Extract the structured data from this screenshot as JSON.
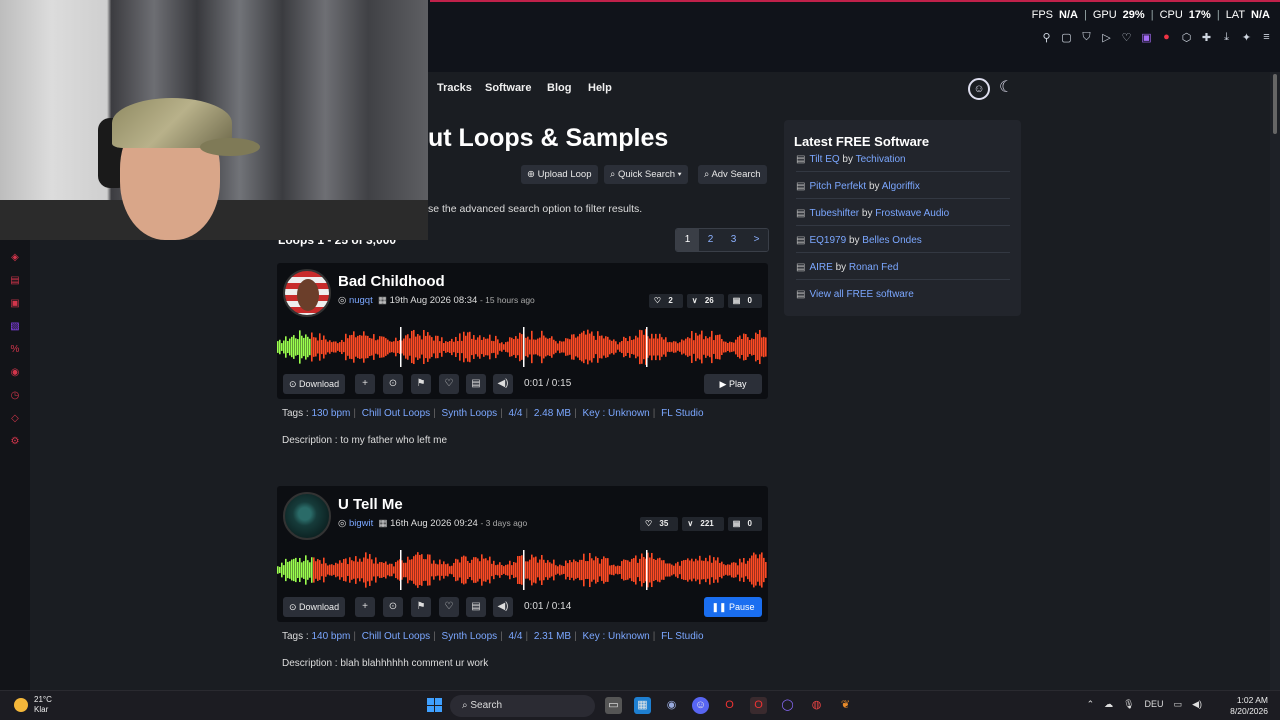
{
  "overlay": {
    "fps_label": "FPS",
    "fps_value": "N/A",
    "gpu_label": "GPU",
    "gpu_value": "29%",
    "cpu_label": "CPU",
    "cpu_value": "17%",
    "lat_label": "LAT",
    "lat_value": "N/A"
  },
  "nav": {
    "tracks": "Tracks",
    "software": "Software",
    "blog": "Blog",
    "help": "Help"
  },
  "page": {
    "title": "ut Loops & Samples",
    "upload_loop": "Upload Loop",
    "quick_search": "Quick Search",
    "adv_search": "Adv Search",
    "hint": "se the advanced search option to filter results.",
    "count": "Loops 1 - 25 of 3,000",
    "pages": [
      "1",
      "2",
      "3",
      ">"
    ]
  },
  "loops": [
    {
      "title": "Bad Childhood",
      "user": "nugqt",
      "date": "19th Aug 2026 08:34",
      "ago": "- 15 hours ago",
      "likes": "2",
      "downs": "26",
      "comments": "0",
      "download": "Download",
      "time": "0:01 / 0:15",
      "play": "Play",
      "tags_label": "Tags :",
      "tags": [
        "130 bpm",
        "Chill Out Loops",
        "Synth Loops",
        "4/4",
        "2.48 MB",
        "Key : Unknown",
        "FL Studio"
      ],
      "description": "Description : to my father who left me"
    },
    {
      "title": "U Tell Me",
      "user": "bigwit",
      "date": "16th Aug 2026 09:24",
      "ago": "- 3 days ago",
      "likes": "35",
      "downs": "221",
      "comments": "0",
      "download": "Download",
      "time": "0:01 / 0:14",
      "play": "Pause",
      "tags_label": "Tags :",
      "tags": [
        "140 bpm",
        "Chill Out Loops",
        "Synth Loops",
        "4/4",
        "2.31 MB",
        "Key : Unknown",
        "FL Studio"
      ],
      "description": "Description : blah blahhhhhh comment ur work"
    }
  ],
  "sidebar": {
    "title": "Latest FREE Software",
    "items": [
      {
        "name": "Tilt EQ",
        "by": "by",
        "author": "Techivation"
      },
      {
        "name": "Pitch Perfekt",
        "by": "by",
        "author": "Algoriffix"
      },
      {
        "name": "Tubeshifter",
        "by": "by",
        "author": "Frostwave Audio"
      },
      {
        "name": "EQ1979",
        "by": "by",
        "author": "Belles Ondes"
      },
      {
        "name": "AIRE",
        "by": "by",
        "author": "Ronan Fed"
      }
    ],
    "view_all": "View all FREE software"
  },
  "taskbar": {
    "temp": "21°C",
    "weather": "Klar",
    "search": "Search",
    "lang": "DEU",
    "time": "1:02 AM",
    "date": "8/20/2026"
  },
  "colors": {
    "accent": "#1a6ef0",
    "wave_played": "#9bff4e",
    "wave_unplayed": "#ff4a24",
    "link": "#7ba7ff"
  }
}
